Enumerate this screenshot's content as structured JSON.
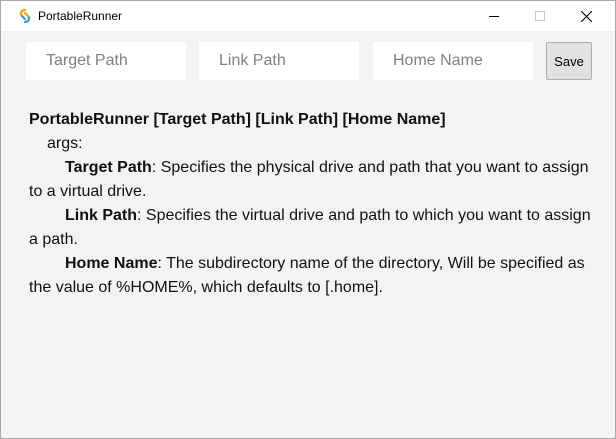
{
  "window": {
    "title": "PortableRunner",
    "icon": "portablerunner-logo-icon",
    "controls": [
      "minimize-icon",
      "maximize-icon",
      "close-icon"
    ]
  },
  "form": {
    "target_path": {
      "placeholder": "Target Path",
      "value": ""
    },
    "link_path": {
      "placeholder": "Link Path",
      "value": ""
    },
    "home_name": {
      "placeholder": "Home Name",
      "value": ""
    },
    "save_label": "Save"
  },
  "help": {
    "usage": "PortableRunner [Target Path] [Link Path] [Home Name]",
    "args_label": "args:",
    "items": [
      {
        "name": "Target Path",
        "desc": ": Specifies the physical drive and path that you want to assign to a virtual drive."
      },
      {
        "name": "Link Path",
        "desc": ": Specifies the virtual drive and path to which you want to assign a path."
      },
      {
        "name": "Home Name",
        "desc": ": The subdirectory name of the directory, Will be specified as the value of %HOME%, which defaults to [.home]."
      }
    ]
  },
  "colors": {
    "window_bg": "#f3f3f3",
    "titlebar_bg": "#ffffff",
    "field_bg": "#ffffff",
    "button_bg": "#e1e1e1"
  }
}
